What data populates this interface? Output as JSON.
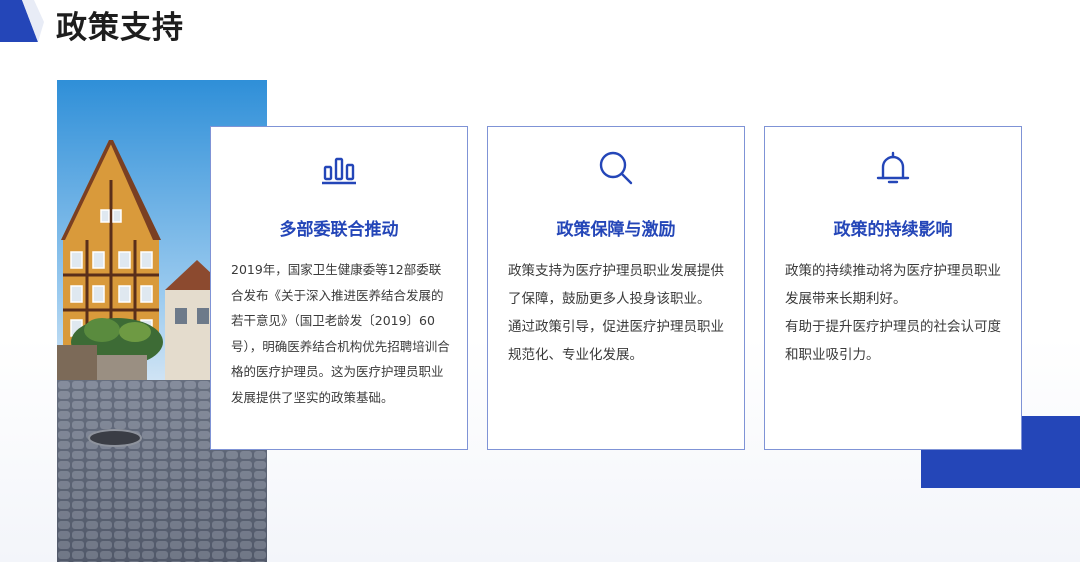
{
  "page": {
    "title": "政策支持"
  },
  "colors": {
    "accent": "#2446b8",
    "card_border": "#7f93d6",
    "title_text": "#1d1d1d",
    "body_text": "#3a3a3a"
  },
  "cards": [
    {
      "icon": "bar-chart-icon",
      "title": "多部委联合推动",
      "paragraphs": [
        "2019年，国家卫生健康委等12部委联合发布《关于深入推进医养结合发展的若干意见》（国卫老龄发〔2019〕60号），明确医养结合机构优先招聘培训合格的医疗护理员。这为医疗护理员职业发展提供了坚实的政策基础。"
      ]
    },
    {
      "icon": "search-icon",
      "title": "政策保障与激励",
      "paragraphs": [
        "政策支持为医疗护理员职业发展提供了保障，鼓励更多人投身该职业。",
        "通过政策引导，促进医疗护理员职业规范化、专业化发展。"
      ]
    },
    {
      "icon": "bell-icon",
      "title": "政策的持续影响",
      "paragraphs": [
        "政策的持续推动将为医疗护理员职业发展带来长期利好。",
        "有助于提升医疗护理员的社会认可度和职业吸引力。"
      ]
    }
  ]
}
